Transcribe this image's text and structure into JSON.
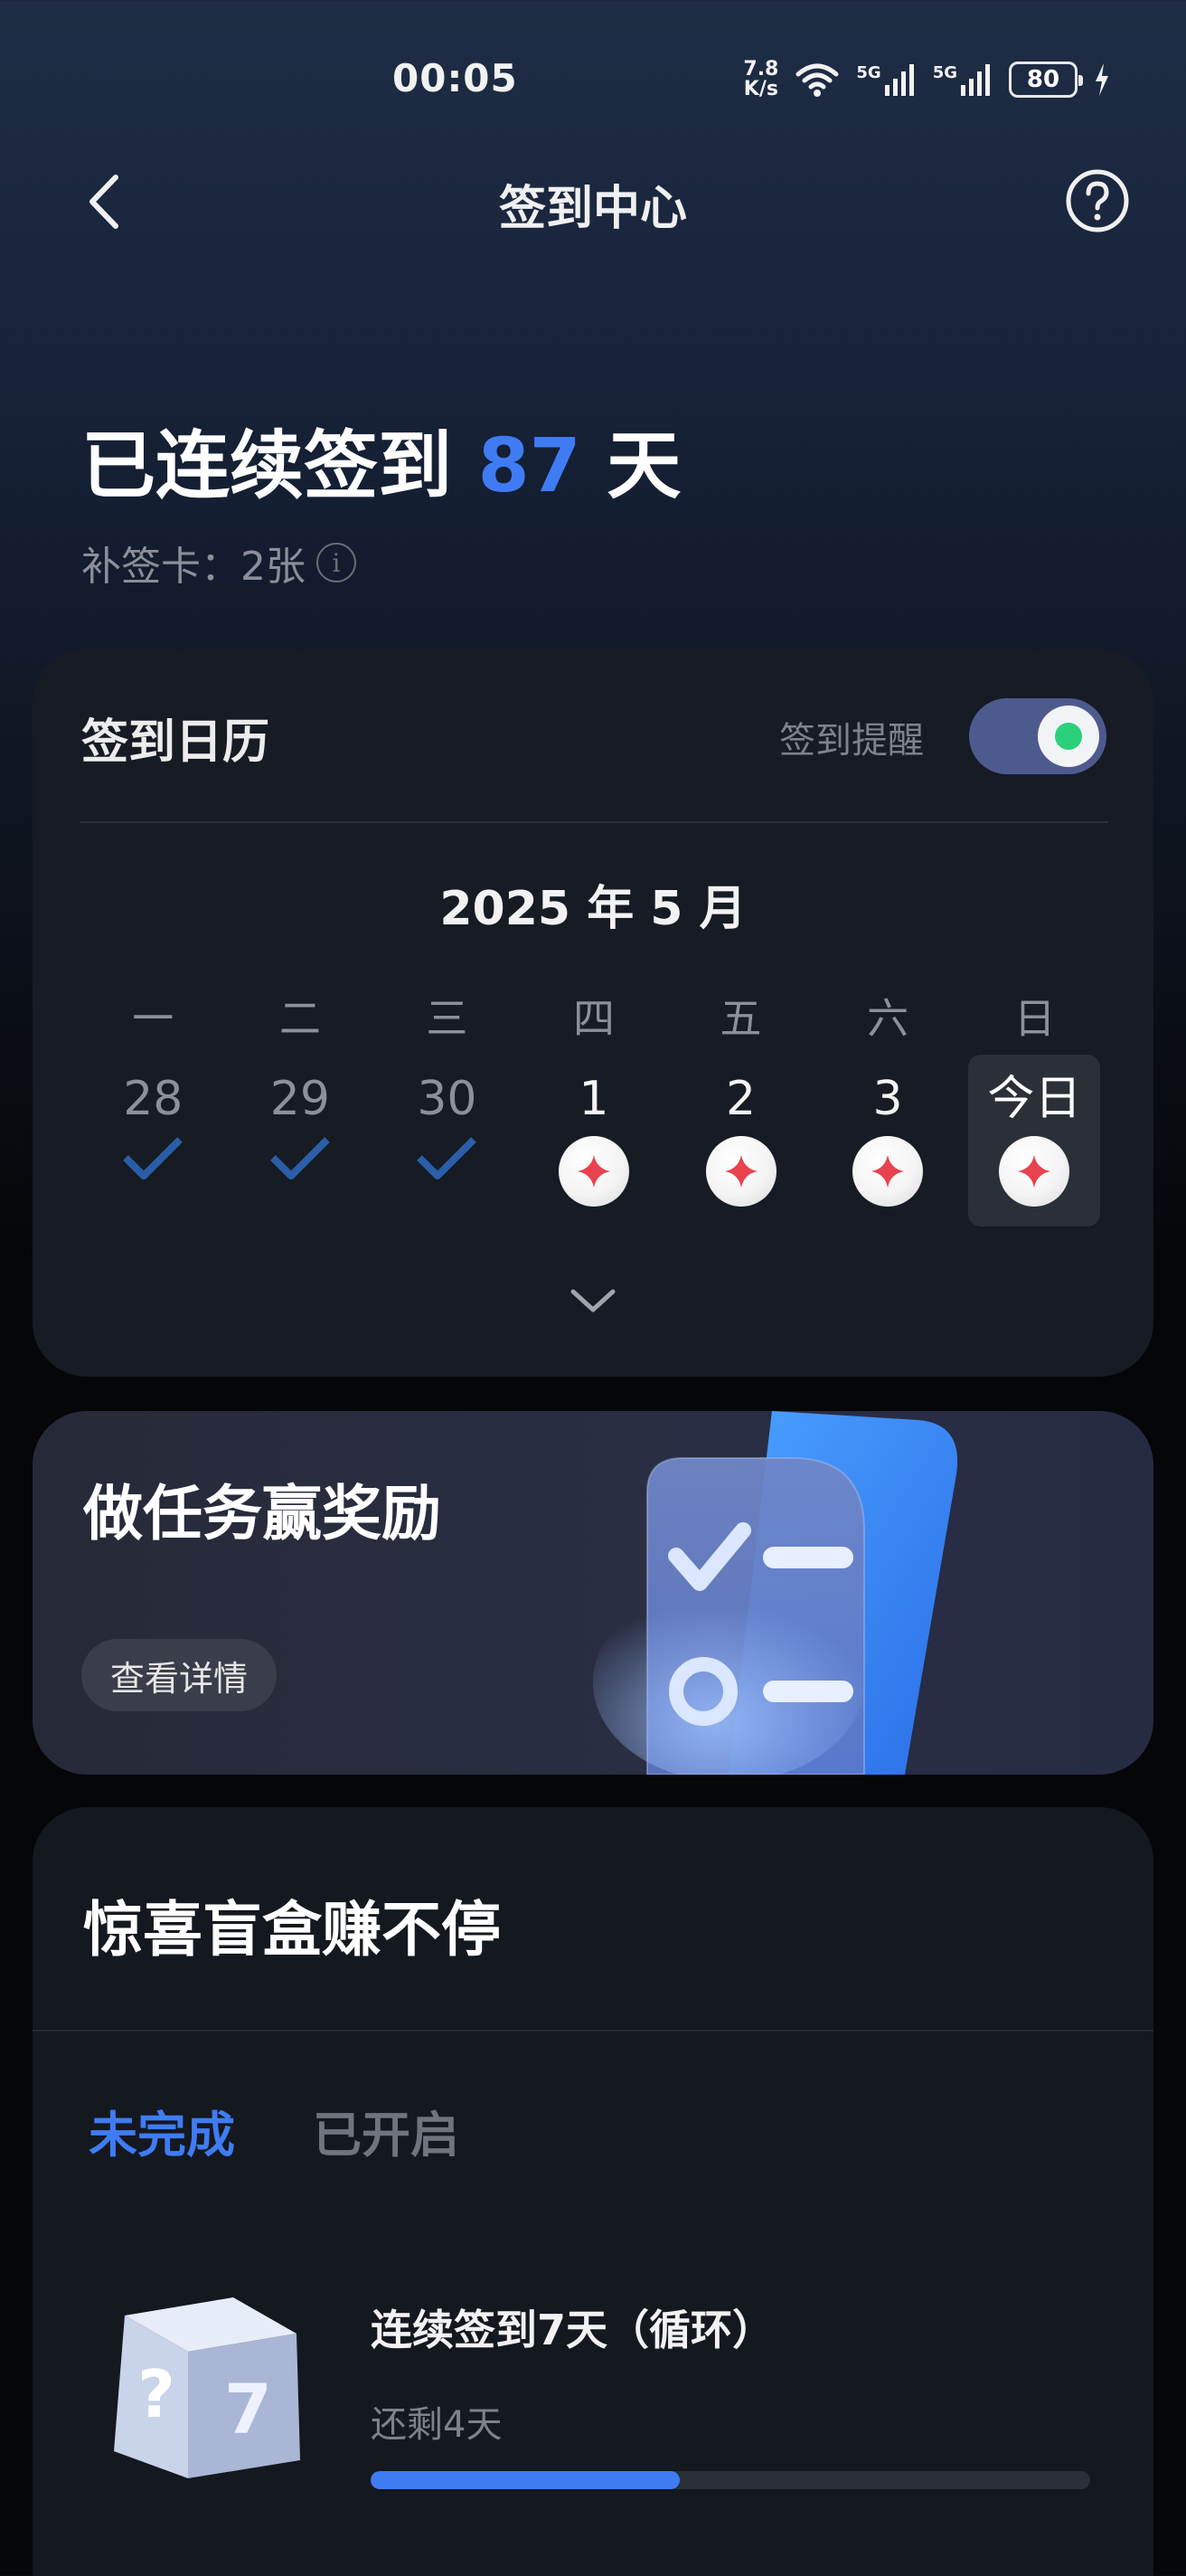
{
  "status_bar": {
    "time": "00:05",
    "net_speed_value": "7.8",
    "net_speed_unit": "K/s",
    "signal_1": "5G",
    "signal_2": "5G",
    "battery": "80"
  },
  "nav": {
    "title": "签到中心"
  },
  "streak": {
    "prefix": "已连续签到",
    "days": "87",
    "suffix": "天",
    "makeup_cards": "补签卡：2张"
  },
  "calendar": {
    "title": "签到日历",
    "reminder_label": "签到提醒",
    "reminder_on": true,
    "month_label": "2025 年 5 月",
    "weekdays": [
      "一",
      "二",
      "三",
      "四",
      "五",
      "六",
      "日"
    ],
    "days": [
      {
        "label": "28",
        "state": "checked"
      },
      {
        "label": "29",
        "state": "checked"
      },
      {
        "label": "30",
        "state": "checked"
      },
      {
        "label": "1",
        "state": "reward"
      },
      {
        "label": "2",
        "state": "reward"
      },
      {
        "label": "3",
        "state": "reward"
      },
      {
        "label": "今日",
        "state": "today"
      }
    ]
  },
  "tasks": {
    "title": "做任务赢奖励",
    "button": "查看详情"
  },
  "blind_box": {
    "title": "惊喜盲盒赚不停",
    "tabs": [
      "未完成",
      "已开启"
    ],
    "item": {
      "title": "连续签到7天（循环）",
      "remaining": "还剩4天",
      "progress": 0.43
    }
  },
  "colors": {
    "accent": "#3f7cf4",
    "toggle_track": "#4d5a8e",
    "toggle_dot": "#2cd07a",
    "check": "#2a5ea8",
    "reward": "#e8424f"
  }
}
